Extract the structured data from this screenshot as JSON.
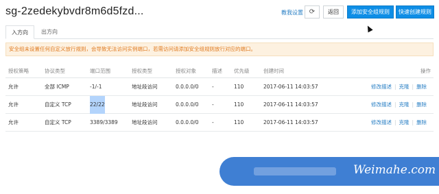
{
  "header": {
    "title": "sg-2zedekybvdr8m6d5fzd...",
    "guide_link": "教我设置",
    "refresh_icon": "refresh-icon",
    "back_label": "返回",
    "add_rule_label": "添加安全组规则",
    "quick_rule_label": "快速创建规则"
  },
  "tabs": [
    {
      "label": "入方向",
      "active": true
    },
    {
      "label": "出方向",
      "active": false
    }
  ],
  "notice": {
    "text": "安全组未设置任何自定义放行规则，会导致无法访问实例端口，若需访问请添加安全组规则放行对应的端口。",
    "color": "#e07b21"
  },
  "table": {
    "columns": [
      "授权策略",
      "协议类型",
      "端口范围",
      "授权类型",
      "授权对象",
      "描述",
      "优先级",
      "创建时间",
      "操作"
    ],
    "rows": [
      {
        "policy": "允许",
        "protocol": "全部 ICMP",
        "port": "-1/-1",
        "auth_type": "地址段访问",
        "object": "0.0.0.0/0",
        "desc": "-",
        "priority": "110",
        "created": "2017-06-11 14:03:57",
        "highlight": false
      },
      {
        "policy": "允许",
        "protocol": "自定义 TCP",
        "port": "22/22",
        "auth_type": "地址段访问",
        "object": "0.0.0.0/0",
        "desc": "-",
        "priority": "110",
        "created": "2017-06-11 14:03:57",
        "highlight": true
      },
      {
        "policy": "允许",
        "protocol": "自定义 TCP",
        "port": "3389/3389",
        "auth_type": "地址段访问",
        "object": "0.0.0.0/0",
        "desc": "-",
        "priority": "110",
        "created": "2017-06-11 14:03:57",
        "highlight": false
      }
    ],
    "actions": {
      "edit": "修改描述",
      "clone": "克隆",
      "delete": "删除"
    }
  },
  "watermark": {
    "text": "Weimahe.com"
  },
  "colors": {
    "primary": "#0e8ee6",
    "link": "#2b80c5",
    "banner": "#3f7fd3"
  }
}
